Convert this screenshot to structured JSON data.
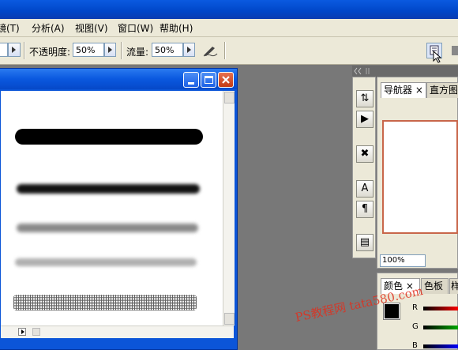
{
  "menubar": {
    "items": [
      "镜(T)",
      "分析(A)",
      "视图(V)",
      "窗口(W)",
      "帮助(H)"
    ]
  },
  "options": {
    "opacity_label": "不透明度:",
    "opacity_value": "50%",
    "flow_label": "流量:",
    "flow_value": "50%"
  },
  "navigator": {
    "tab_navigator": "导航器",
    "tab_histogram": "直方图",
    "close_glyph": "×",
    "zoom_value": "100%"
  },
  "color_panel": {
    "tab_color": "颜色",
    "tab_swatches": "色板",
    "tab_third": "样",
    "close_glyph": "×",
    "channel_r": "R",
    "channel_g": "G",
    "channel_b": "B"
  },
  "tool_glyphs": {
    "text_tool": "A",
    "paragraph": "¶"
  },
  "watermark": "PS教程网 tata580.com",
  "colors": {
    "titlebar": "#0046c8",
    "panel_bg": "#ece9d8",
    "workspace": "#787878",
    "close_button": "#c43a14"
  }
}
